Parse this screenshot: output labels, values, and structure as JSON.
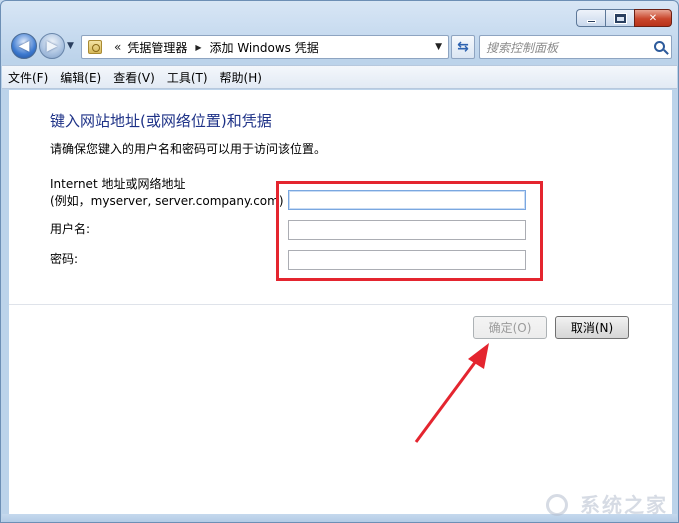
{
  "titlebar": {
    "minimize_label": "",
    "maximize_label": "",
    "close_label": "✕"
  },
  "navigation": {
    "back_icon": "back-arrow-icon",
    "forward_icon": "forward-arrow-icon",
    "breadcrumb_overflow": "«",
    "breadcrumbs": [
      "凭据管理器",
      "添加 Windows 凭据"
    ],
    "search_placeholder": "搜索控制面板"
  },
  "menu": {
    "items": [
      "文件(F)",
      "编辑(E)",
      "查看(V)",
      "工具(T)",
      "帮助(H)"
    ]
  },
  "form": {
    "title": "键入网站地址(或网络位置)和凭据",
    "description": "请确保您键入的用户名和密码可以用于访问该位置。",
    "internet_label_line1": "Internet 地址或网络地址",
    "internet_label_line2": "(例如，myserver, server.company.com)",
    "internet_value": "",
    "username_label": "用户名:",
    "username_value": "",
    "password_label": "密码:",
    "password_value": ""
  },
  "buttons": {
    "ok": "确定(O)",
    "cancel": "取消(N)"
  },
  "annotation": {
    "highlight_color": "#e4252f"
  },
  "watermark": {
    "text": "系统之家"
  }
}
